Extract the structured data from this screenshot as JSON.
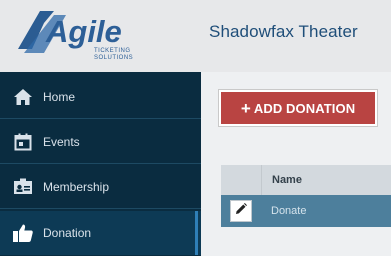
{
  "header": {
    "logo_text": "Agile",
    "logo_tagline_1": "TICKETING",
    "logo_tagline_2": "SOLUTIONS",
    "theater_name": "Shadowfax Theater"
  },
  "sidebar": {
    "items": [
      {
        "label": "Home",
        "icon": "home-icon"
      },
      {
        "label": "Events",
        "icon": "calendar-icon"
      },
      {
        "label": "Membership",
        "icon": "membership-card-icon"
      },
      {
        "label": "Donation",
        "icon": "thumbs-up-icon"
      }
    ],
    "active_item": "Donation"
  },
  "main": {
    "add_button_label": "ADD DONATION",
    "table": {
      "columns": [
        "",
        "Name"
      ],
      "rows": [
        {
          "name": "Donate"
        }
      ]
    }
  },
  "colors": {
    "brand_blue": "#1f4e79",
    "sidebar_bg": "#0a2c40",
    "add_button": "#b94442",
    "selected_row": "#4d7f9c"
  }
}
